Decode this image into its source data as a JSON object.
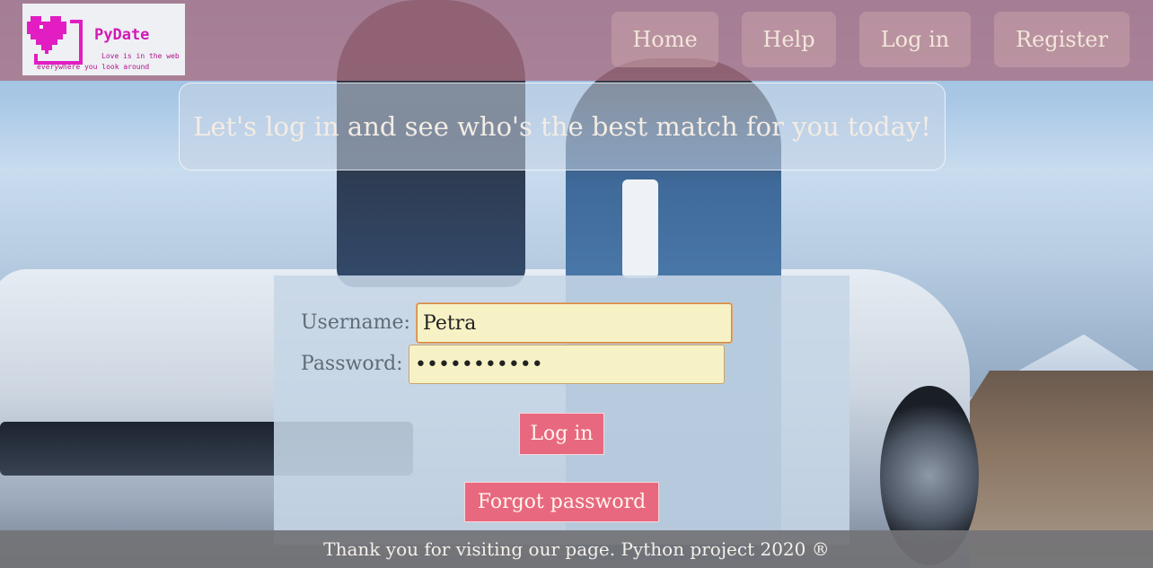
{
  "logo": {
    "brand": "PyDate",
    "tagline_line1": "Love is in the web",
    "tagline_line2": "everywhere you look around",
    "icon": "pixel-heart-icon",
    "color": "#d11ab8"
  },
  "nav": {
    "home": "Home",
    "help": "Help",
    "login": "Log in",
    "register": "Register"
  },
  "banner": {
    "text": "Let's log in and see who's the best match for you today!"
  },
  "login_form": {
    "username_label": "Username:",
    "username_value": "Petra",
    "password_label": "Password:",
    "password_value": "petra123456",
    "login_button": "Log in",
    "forgot_button": "Forgot password"
  },
  "footer": {
    "text": "Thank you for visiting our page. Python project 2020 ®"
  },
  "colors": {
    "header_bg": "#aa6e82",
    "button": "#e8697f",
    "input_bg": "#f7f2c6",
    "panel": "#c6d6e6"
  }
}
